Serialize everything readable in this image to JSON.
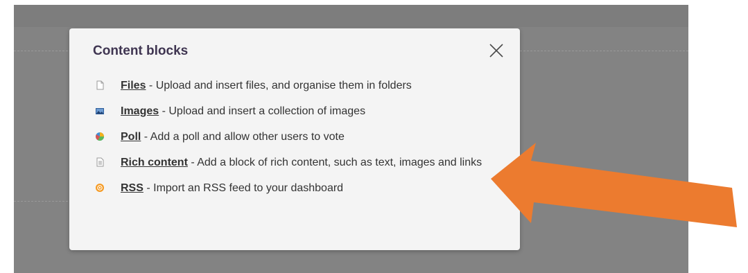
{
  "modal": {
    "title": "Content blocks"
  },
  "blocks": [
    {
      "name": "Files",
      "description": " - Upload and insert files, and organise them in folders",
      "icon": "file-icon"
    },
    {
      "name": "Images",
      "description": " - Upload and insert a collection of images",
      "icon": "image-icon"
    },
    {
      "name": "Poll",
      "description": " - Add a poll and allow other users to vote",
      "icon": "poll-icon"
    },
    {
      "name": "Rich content",
      "description": " - Add a block of rich content, such as text, images and links",
      "icon": "rich-content-icon"
    },
    {
      "name": "RSS",
      "description": " - Import an RSS feed to your dashboard",
      "icon": "rss-icon"
    }
  ],
  "colors": {
    "title": "#3f3551",
    "modal_bg": "#f4f4f4",
    "overlay": "#838383",
    "annotation_arrow": "#ec7b2f"
  }
}
